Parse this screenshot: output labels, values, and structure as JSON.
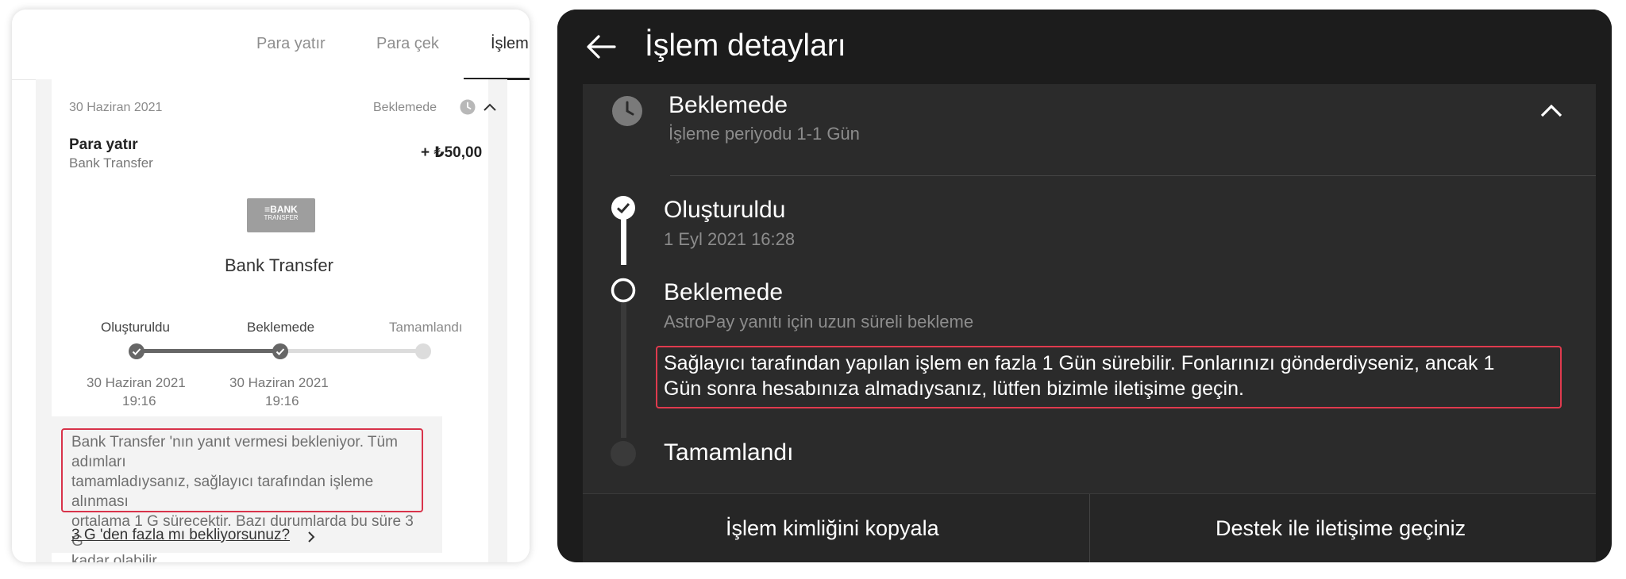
{
  "left_panel": {
    "tabs": [
      "Para yatır",
      "Para çek",
      "İşlem"
    ],
    "transaction": {
      "date": "30 Haziran 2021",
      "status": "Beklemede",
      "title": "Para yatır",
      "method": "Bank Transfer",
      "amount": "+ ₺50,00",
      "logo_text_line1": "≡BANK",
      "logo_text_line2": "TRANSFER",
      "method_heading": "Bank Transfer"
    },
    "steps": [
      {
        "label": "Oluşturuldu",
        "date": "30 Haziran 2021",
        "time": "19:16",
        "done": true
      },
      {
        "label": "Beklemede",
        "date": "30 Haziran 2021",
        "time": "19:16",
        "done": true
      },
      {
        "label": "Tamamlandı",
        "date": "",
        "time": "",
        "done": false
      }
    ],
    "notice_lines": [
      "Bank Transfer 'nın yanıt vermesi bekleniyor. Tüm adımları",
      "tamamladıysanız, sağlayıcı tarafından işleme alınması",
      "ortalama 1 G sürecektir. Bazı durumlarda bu süre 3 G",
      "kadar olabilir."
    ],
    "help_link": "3 G 'den fazla mı bekliyorsunuz?",
    "colors": {
      "accent_red": "#d8334a",
      "step_done": "#666666",
      "step_pending": "#d9d9d9"
    }
  },
  "right_panel": {
    "title": "İşlem detayları",
    "status_header": {
      "status": "Beklemede",
      "subtitle": "İşleme periyodu 1-1 Gün"
    },
    "timeline": [
      {
        "label": "Oluşturuldu",
        "sub": "1 Eyl 2021 16:28",
        "state": "done"
      },
      {
        "label": "Beklemede",
        "sub": "AstroPay yanıtı için uzun süreli bekleme",
        "state": "current"
      },
      {
        "label": "Tamamlandı",
        "sub": "",
        "state": "pending"
      }
    ],
    "notice_lines": [
      "Sağlayıcı tarafından yapılan işlem en fazla 1 Gün sürebilir. Fonlarınızı gönderdiyseniz, ancak 1",
      "Gün sonra hesabınıza almadıysanız, lütfen bizimle iletişime geçin."
    ],
    "buttons": {
      "copy_id": "İşlem kimliğini kopyala",
      "contact_support": "Destek ile iletişime geçiniz"
    },
    "colors": {
      "background": "#1c1c1c",
      "accent_red": "#e03a4e"
    }
  }
}
